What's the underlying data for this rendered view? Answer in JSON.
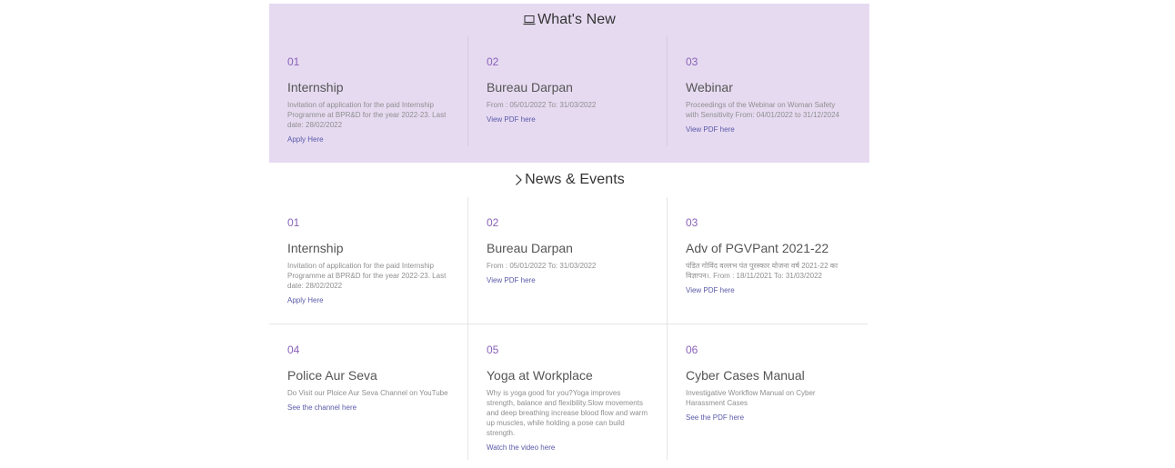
{
  "whats_new": {
    "title": "What's New",
    "items": [
      {
        "num": "01",
        "title": "Internship",
        "desc": "Invitation of application for the paid Internship Programme at BPR&D for the year 2022-23. Last date: 28/02/2022",
        "link": "Apply Here"
      },
      {
        "num": "02",
        "title": "Bureau Darpan",
        "desc": "From : 05/01/2022 To: 31/03/2022",
        "link": "View PDF here"
      },
      {
        "num": "03",
        "title": "Webinar",
        "desc": "Proceedings of the Webinar on Woman Safety with Sensitivity From: 04/01/2022 to 31/12/2024",
        "link": "View PDF here"
      }
    ]
  },
  "news_events": {
    "title": "News & Events",
    "items": [
      {
        "num": "01",
        "title": "Internship",
        "desc": "Invitation of application for the paid Internship Programme at BPR&D for the year 2022-23. Last date: 28/02/2022",
        "link": "Apply Here"
      },
      {
        "num": "02",
        "title": "Bureau Darpan",
        "desc": "From : 05/01/2022 To: 31/03/2022",
        "link": "View PDF here"
      },
      {
        "num": "03",
        "title": "Adv of PGVPant 2021-22",
        "desc": "पंडित गोविंद वल्लभ पंत पुरस्कार योजना वर्ष 2021-22 का विज्ञापन।. From : 18/11/2021 To: 31/03/2022",
        "link": "View PDF here"
      },
      {
        "num": "04",
        "title": "Police Aur Seva",
        "desc": "Do Visit our Ploice Aur Seva Channel on YouTube",
        "link": "See the channel here"
      },
      {
        "num": "05",
        "title": "Yoga at Workplace",
        "desc": "Why is yoga good for you?Yoga improves strength, balance and flexibility.Slow movements and deep breathing increase blood flow and warm up muscles, while holding a pose can build strength.",
        "link": "Watch the video here"
      },
      {
        "num": "06",
        "title": "Cyber Cases Manual",
        "desc": "Investigative Workflow Manual on Cyber Harassment Cases",
        "link": "See the PDF here"
      }
    ]
  },
  "icons": {
    "whats_new_icon": "laptop-icon",
    "news_events_icon": "chevron-right-icon"
  },
  "colors": {
    "whats_new_bg": "#e6daf1",
    "number": "#8a62b8",
    "link": "#5a5aa8"
  }
}
